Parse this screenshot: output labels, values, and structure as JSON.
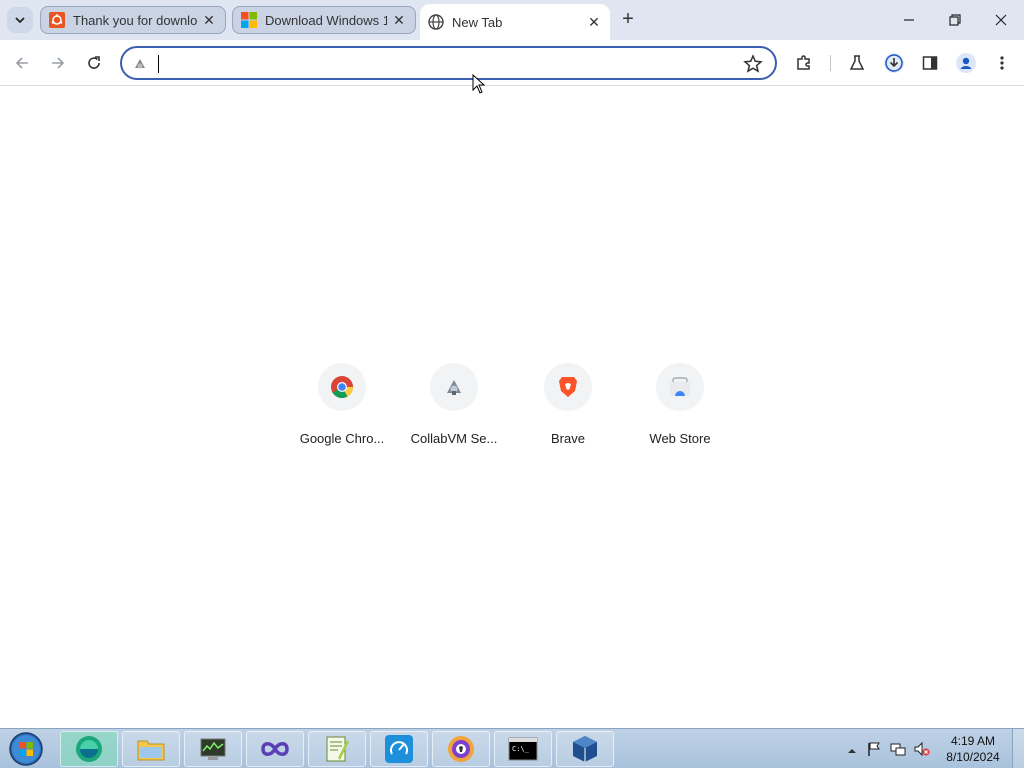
{
  "tabs": [
    {
      "title": "Thank you for downlo",
      "favicon": "ubuntu-icon"
    },
    {
      "title": "Download Windows 1",
      "favicon": "windows-icon"
    },
    {
      "title": "New Tab",
      "favicon": "globe-icon",
      "active": true
    }
  ],
  "omnibox": {
    "value": "",
    "placeholder": ""
  },
  "shortcuts": [
    {
      "label": "Google Chro...",
      "icon": "chrome-icon"
    },
    {
      "label": "CollabVM Se...",
      "icon": "collabvm-icon"
    },
    {
      "label": "Brave",
      "icon": "brave-icon"
    },
    {
      "label": "Web Store",
      "icon": "web-store-icon"
    }
  ],
  "taskbar": {
    "apps": [
      "browser-app",
      "file-explorer",
      "system-monitor",
      "visual-studio",
      "notepad-plus-plus",
      "speedtest",
      "brave-browser",
      "command-prompt",
      "virtualbox"
    ]
  },
  "clock": {
    "time": "4:19 AM",
    "date": "8/10/2024"
  },
  "colors": {
    "tabstrip": "#dfe6f2",
    "omnibox_border": "#3a5fb0",
    "taskbar": "#bfd2e6"
  }
}
